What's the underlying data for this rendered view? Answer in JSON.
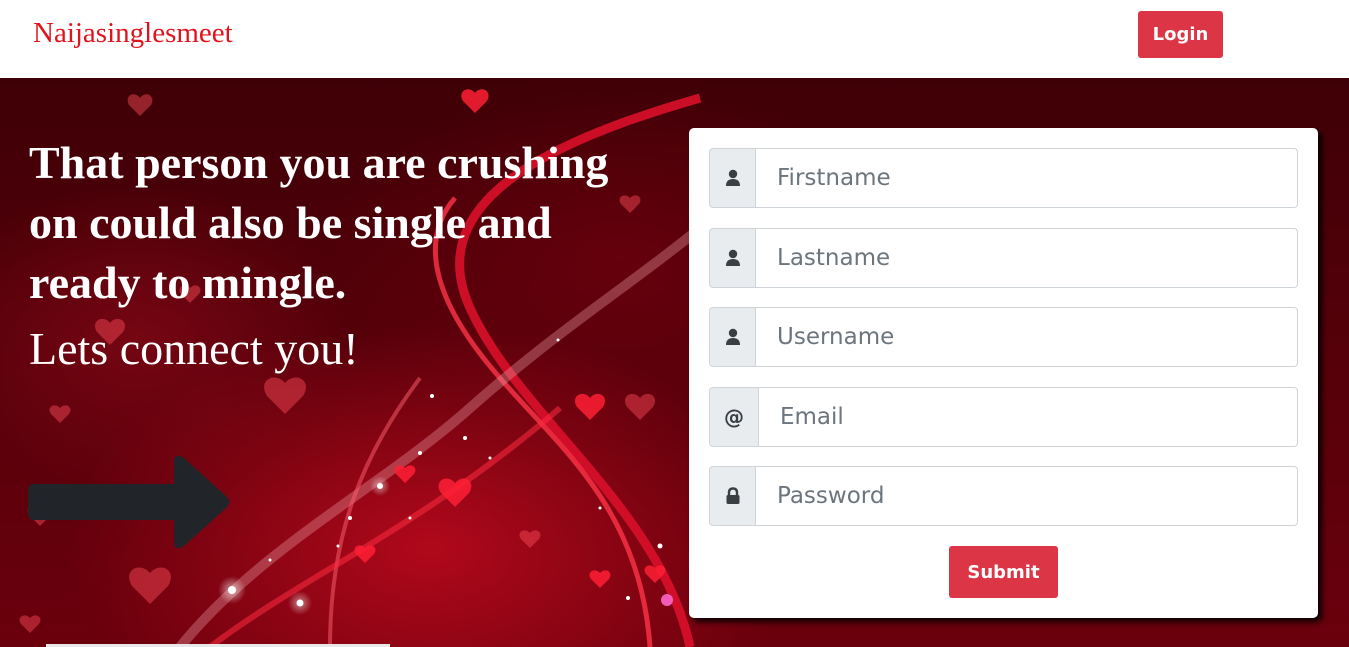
{
  "navbar": {
    "brand": "Naijasinglesmeet",
    "login_label": "Login"
  },
  "hero": {
    "headline": "That person you are crushing on could also be single and ready to mingle.",
    "subline": "Lets connect you!"
  },
  "form": {
    "fields": [
      {
        "icon": "user-icon",
        "placeholder": "Firstname",
        "value": ""
      },
      {
        "icon": "user-icon",
        "placeholder": "Lastname",
        "value": ""
      },
      {
        "icon": "user-icon",
        "placeholder": "Username",
        "value": ""
      },
      {
        "icon": "at-icon",
        "prefix_text": "@",
        "placeholder": "Email",
        "value": ""
      },
      {
        "icon": "lock-icon",
        "placeholder": "Password",
        "value": ""
      }
    ],
    "submit_label": "Submit"
  },
  "colors": {
    "accent": "#dc3545",
    "brand": "#e0141e",
    "hero_background": "#520009"
  }
}
